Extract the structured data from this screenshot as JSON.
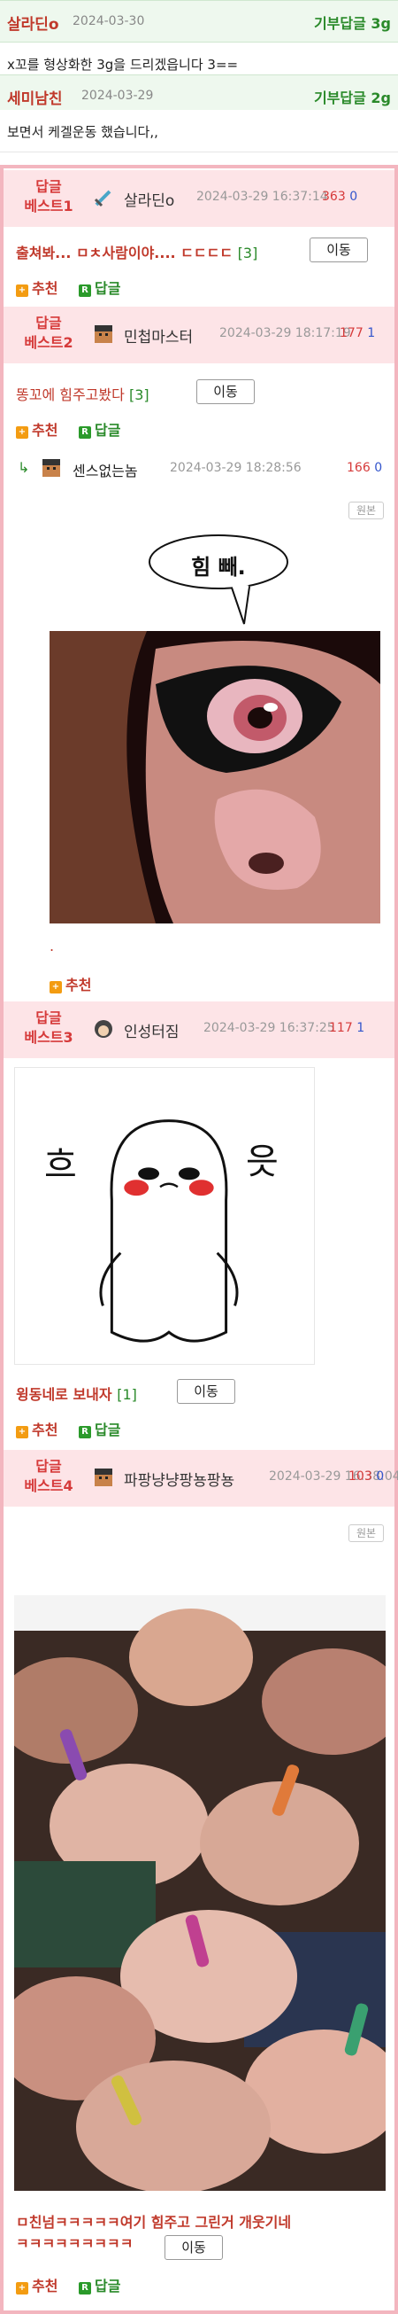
{
  "donations": [
    {
      "user": "살라딘o",
      "date": "2024-03-30",
      "label": "기부답글",
      "amount": "3g",
      "text": "x꼬를 형상화한 3g을 드리겠읍니다 3=="
    },
    {
      "user": "세미남친",
      "date": "2024-03-29",
      "label": "기부답글",
      "amount": "2g",
      "text": "보면서 케겔운동 했습니다,,"
    }
  ],
  "best": [
    {
      "rank": "답글\n베스트1",
      "user": "살라딘o",
      "date": "2024-03-29 16:37:14",
      "up": "363",
      "down": "0",
      "title": "출쳐봐... ㅁㅊ사람이야.... ㄷㄷㄷㄷ",
      "replies": "[3]"
    },
    {
      "rank": "답글\n베스트2",
      "user": "민첩마스터",
      "date": "2024-03-29 18:17:19",
      "up": "177",
      "down": "1",
      "title": "똥꼬에 힘주고봤다",
      "replies": "[3]"
    },
    {
      "rank": "답글\n베스트3",
      "user": "인성터짐",
      "date": "2024-03-29 16:37:25",
      "up": "117",
      "down": "1",
      "title": "윙동네로 보내자",
      "replies": "[1]"
    },
    {
      "rank": "답글\n베스트4",
      "user": "파팡냥냥팡뇽팡뇽",
      "date": "2024-03-29 16:38:04",
      "up": "103",
      "down": "0",
      "title": "ㅁ친넘ㅋㅋㅋㅋㅋ여기 힘주고 그린거 개웃기네 ㅋㅋㅋㅋㅋㅋㅋㅋㅋ",
      "replies": ""
    }
  ],
  "nested_reply": {
    "user": "센스없는놈",
    "date": "2024-03-29 18:28:56",
    "up": "166",
    "down": "0",
    "orig": "원본",
    "bubble": "힘 빼.",
    "dot": "."
  },
  "image_text": {
    "left_char": "흐",
    "right_char": "읏"
  },
  "labels": {
    "move": "이동",
    "recommend": "추천",
    "reply": "답글",
    "rec_box": "+",
    "rep_box": "R",
    "orig": "원본"
  },
  "colors": {
    "accent_red": "#d63a3a",
    "accent_green": "#2a8a2a",
    "frame_pink": "#f3b6bf",
    "head_pink": "#fde4e7"
  }
}
